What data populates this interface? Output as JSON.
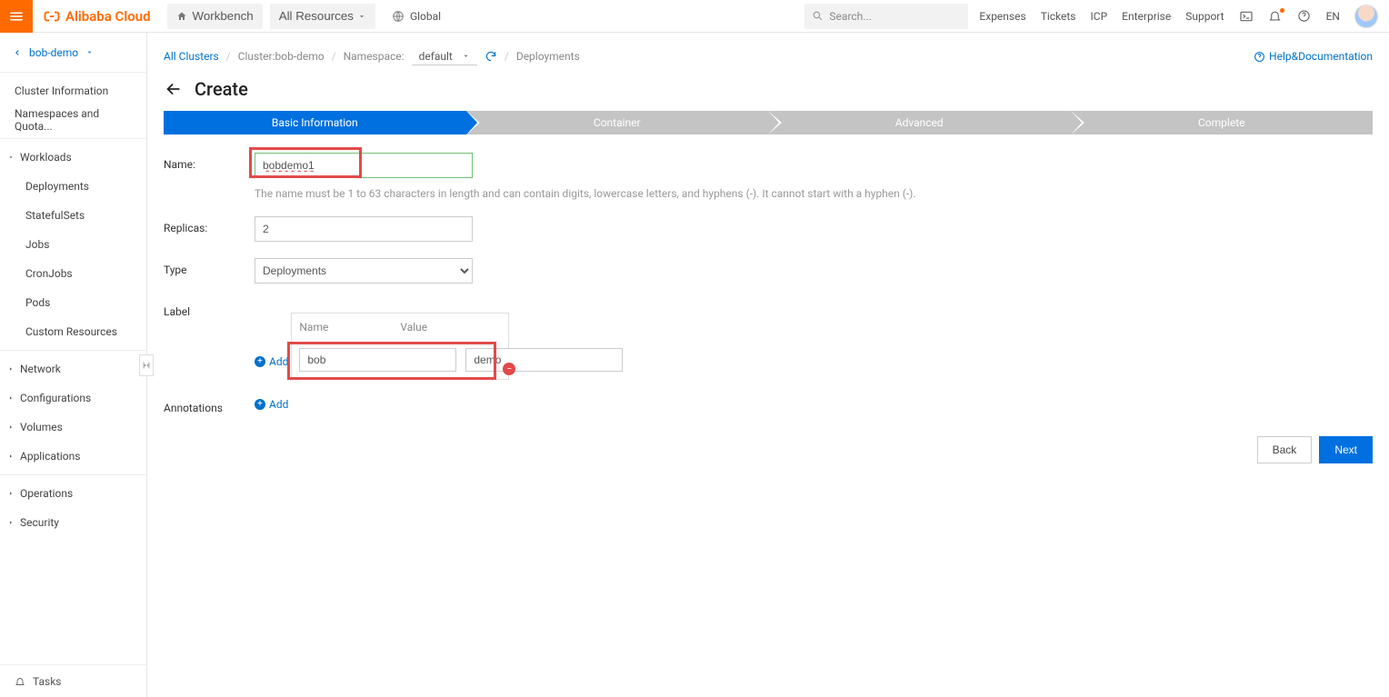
{
  "top": {
    "brand": "Alibaba Cloud",
    "workbench": "Workbench",
    "all_resources": "All Resources",
    "region": "Global",
    "search_placeholder": "Search...",
    "nav": [
      "Expenses",
      "Tickets",
      "ICP",
      "Enterprise",
      "Support"
    ],
    "lang": "EN"
  },
  "sidebar": {
    "project": "bob-demo",
    "items_top": [
      "Cluster Information",
      "Namespaces and Quota..."
    ],
    "workloads": {
      "label": "Workloads",
      "children": [
        "Deployments",
        "StatefulSets",
        "Jobs",
        "CronJobs",
        "Pods",
        "Custom Resources"
      ]
    },
    "groups_rest": [
      "Network",
      "Configurations",
      "Volumes",
      "Applications",
      "Operations",
      "Security"
    ],
    "tasks": "Tasks"
  },
  "breadcrumb": {
    "all_clusters": "All Clusters",
    "cluster": "Cluster:bob-demo",
    "namespace_label": "Namespace:",
    "namespace_value": "default",
    "deployments": "Deployments"
  },
  "helpdoc": "Help&Documentation",
  "page_title": "Create",
  "steps": [
    "Basic Information",
    "Container",
    "Advanced",
    "Complete"
  ],
  "form": {
    "name_label": "Name:",
    "name_value": "bobdemo1",
    "name_hint": "The name must be 1 to 63 characters in length and can contain digits, lowercase letters, and hyphens (-). It cannot start with a hyphen (-).",
    "replicas_label": "Replicas:",
    "replicas_value": "2",
    "type_label": "Type",
    "type_value": "Deployments",
    "label_label": "Label",
    "add": "Add",
    "label_cols": {
      "name": "Name",
      "value": "Value"
    },
    "label_row": {
      "name": "bob",
      "value": "demo"
    },
    "annotations_label": "Annotations"
  },
  "footer": {
    "back": "Back",
    "next": "Next"
  }
}
